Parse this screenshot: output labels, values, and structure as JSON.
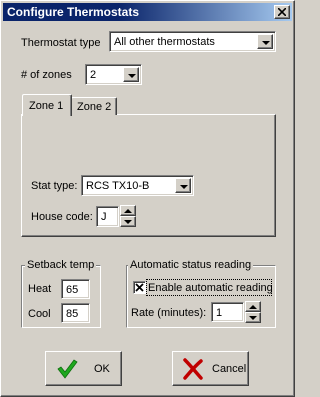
{
  "window": {
    "title": "Configure Thermostats"
  },
  "thermostat_type": {
    "label": "Thermostat type",
    "value": "All other thermostats"
  },
  "zones": {
    "label": "# of zones",
    "value": "2"
  },
  "tabs": [
    {
      "label": "Zone 1"
    },
    {
      "label": "Zone 2"
    }
  ],
  "zone": {
    "stat_type": {
      "label": "Stat type:",
      "value": "RCS TX10-B"
    },
    "house_code": {
      "label": "House code:",
      "value": "J"
    }
  },
  "setback": {
    "title": "Setback temp",
    "heat": {
      "label": "Heat",
      "value": "65"
    },
    "cool": {
      "label": "Cool",
      "value": "85"
    }
  },
  "status_reading": {
    "title": "Automatic status reading",
    "enable": {
      "label": "Enable automatic reading",
      "checked": true
    },
    "rate": {
      "label": "Rate (minutes):",
      "value": "1"
    }
  },
  "buttons": {
    "ok": "OK",
    "cancel": "Cancel"
  },
  "colors": {
    "title_bar": "#0a246a",
    "ok_check": "#1fa81f",
    "cancel_x": "#c00000"
  },
  "icons": {
    "close": "close-icon",
    "ok": "green-check-icon",
    "cancel": "red-x-icon"
  }
}
